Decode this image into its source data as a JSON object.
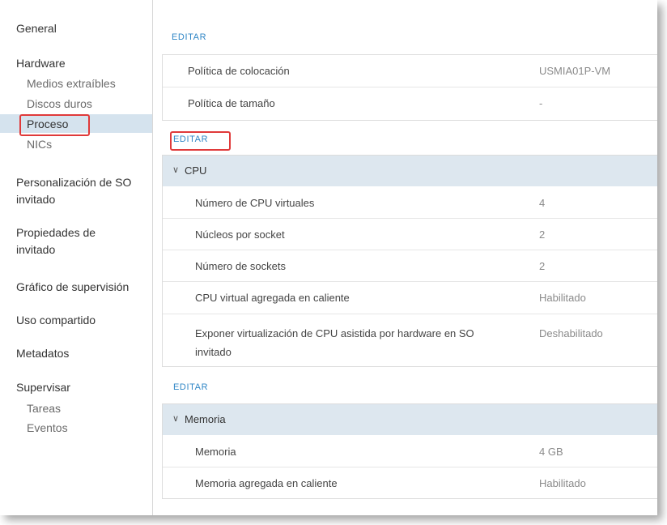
{
  "sidebar": {
    "general": "General",
    "hardware": "Hardware",
    "hardware_items": [
      "Medios extraíbles",
      "Discos duros",
      "Proceso",
      "NICs"
    ],
    "guest_os_custom_1": "Personalización de SO",
    "guest_os_custom_2": "invitado",
    "guest_props_1": "Propiedades de",
    "guest_props_2": "invitado",
    "monitoring_chart": "Gráfico de supervisión",
    "sharing": "Uso compartido",
    "metadata": "Metadatos",
    "monitor": "Supervisar",
    "monitor_items": [
      "Tareas",
      "Eventos"
    ]
  },
  "main": {
    "edit_label": "EDITAR",
    "policies": [
      {
        "label": "Política de colocación",
        "value": "USMIA01P-VM"
      },
      {
        "label": "Política de tamaño",
        "value": "-"
      }
    ],
    "cpu": {
      "title": "CPU",
      "rows": [
        {
          "label": "Número de CPU virtuales",
          "value": "4"
        },
        {
          "label": "Núcleos por socket",
          "value": "2"
        },
        {
          "label": "Número de sockets",
          "value": "2"
        },
        {
          "label": "CPU virtual agregada en caliente",
          "value": "Habilitado"
        },
        {
          "label_1": "Exponer virtualización de CPU asistida por hardware en SO",
          "label_2": "invitado",
          "value": "Deshabilitado"
        }
      ]
    },
    "memory": {
      "title": "Memoria",
      "rows": [
        {
          "label": "Memoria",
          "value": "4 GB"
        },
        {
          "label": "Memoria agregada en caliente",
          "value": "Habilitado"
        }
      ]
    }
  },
  "colors": {
    "accent": "#2f86c6",
    "highlight_red": "#e03a3a",
    "selected_bg": "#d5e3ee",
    "section_bg": "#dde7ef"
  }
}
